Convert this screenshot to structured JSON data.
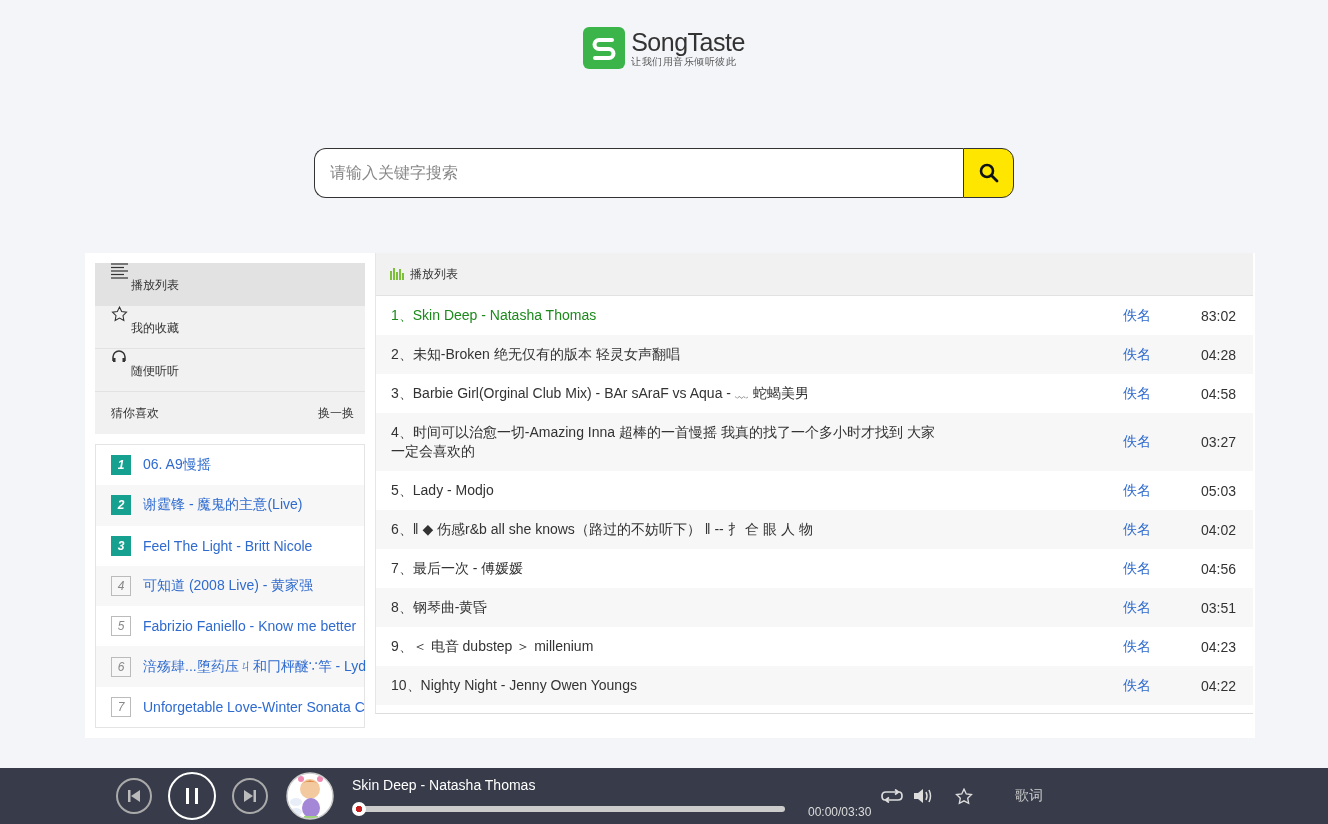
{
  "logo": {
    "name": "SongTaste",
    "slogan": "让我们用音乐倾听彼此"
  },
  "search": {
    "placeholder": "请输入关键字搜索"
  },
  "sidebar": {
    "items": [
      {
        "label": "播放列表",
        "selected": true
      },
      {
        "label": "我的收藏",
        "selected": false
      },
      {
        "label": "随便听听",
        "selected": false
      }
    ],
    "recommend_title": "猜你喜欢",
    "refresh": "换一换"
  },
  "recommendations": [
    {
      "rank": "1",
      "title": "06. A9慢摇",
      "top": true
    },
    {
      "rank": "2",
      "title": "谢霆锋 - 魔鬼的主意(Live)",
      "top": true
    },
    {
      "rank": "3",
      "title": "Feel The Light - Britt Nicole",
      "top": true
    },
    {
      "rank": "4",
      "title": "可知道 (2008 Live) - 黄家强",
      "top": false
    },
    {
      "rank": "5",
      "title": "Fabrizio Faniello - Know me better",
      "top": false
    },
    {
      "rank": "6",
      "title": "涪殇肆...堕药压ㄐ和冂枰醚∵竿 - Lyd",
      "top": false
    },
    {
      "rank": "7",
      "title": "Unforgetable Love-Winter Sonata C",
      "top": false
    }
  ],
  "playlist": {
    "title": "播放列表",
    "rows": [
      {
        "title": "1、Skin Deep - Natasha Thomas",
        "artist": "佚名",
        "duration": "83:02",
        "playing": true
      },
      {
        "title": "2、未知-Broken 绝无仅有的版本 轻灵女声翻唱",
        "artist": "佚名",
        "duration": "04:28",
        "playing": false
      },
      {
        "title": "3、Barbie Girl(Orginal Club Mix) - BAr sAraF vs Aqua - ﹏ 蛇蝎美男",
        "artist": "佚名",
        "duration": "04:58",
        "playing": false
      },
      {
        "title": "4、时间可以治愈一切-Amazing Inna 超棒的一首慢摇 我真的找了一个多小时才找到 大家一定会喜欢的",
        "artist": "佚名",
        "duration": "03:27",
        "playing": false
      },
      {
        "title": "5、Lady - Modjo",
        "artist": "佚名",
        "duration": "05:03",
        "playing": false
      },
      {
        "title": "6、‖ ◆ 伤感r&b all she knows（路过的不妨听下） ‖ -- 扌 仺 眼 人 物",
        "artist": "佚名",
        "duration": "04:02",
        "playing": false
      },
      {
        "title": "7、最后一次 - 傅媛媛",
        "artist": "佚名",
        "duration": "04:56",
        "playing": false
      },
      {
        "title": "8、钢琴曲-黄昏",
        "artist": "佚名",
        "duration": "03:51",
        "playing": false
      },
      {
        "title": "9、＜ 电音 dubstep ＞ millenium",
        "artist": "佚名",
        "duration": "04:23",
        "playing": false
      },
      {
        "title": "10、Nighty Night - Jenny Owen Youngs",
        "artist": "佚名",
        "duration": "04:22",
        "playing": false
      }
    ]
  },
  "player": {
    "track": "Skin Deep - Natasha Thomas",
    "level": 0,
    "time": "00:00/03:30",
    "playing": true,
    "lyrics": "歌词"
  }
}
